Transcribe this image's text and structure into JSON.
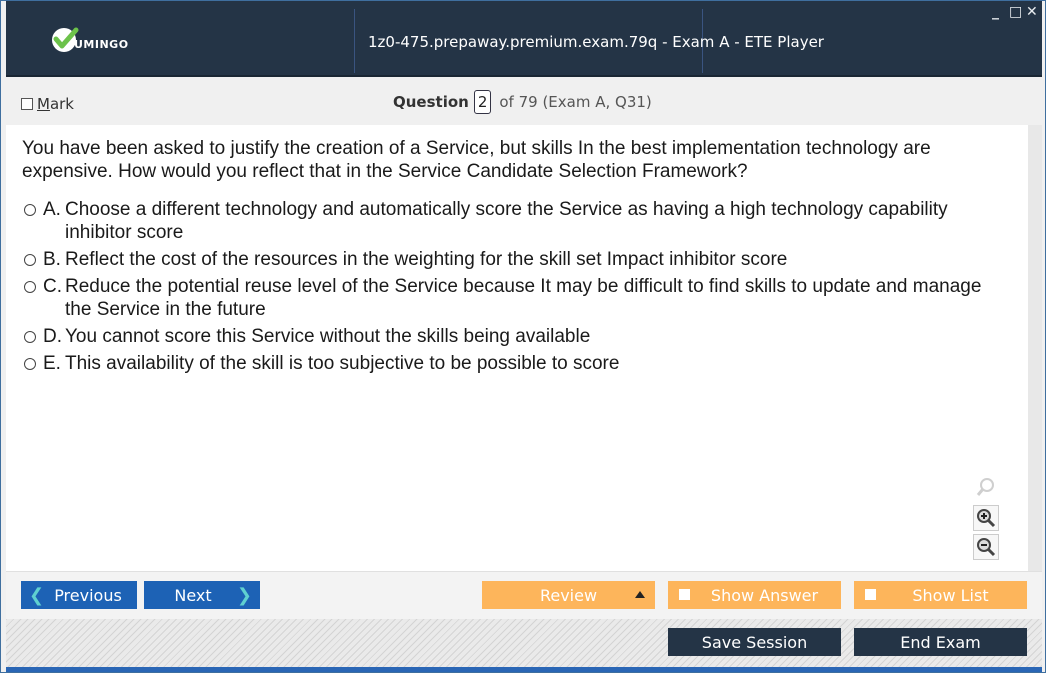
{
  "titlebar": {
    "logo_text": "UMINGO",
    "title": "1z0-475.prepaway.premium.exam.79q - Exam A - ETE Player",
    "controls": {
      "minimize": "_",
      "maximize": "□",
      "close": "✕"
    }
  },
  "header": {
    "mark_label": "Mark",
    "question_word": "Question",
    "question_number": "2",
    "of_text": "of 79 (Exam A, Q31)"
  },
  "question": {
    "text": "You have been asked to justify the creation of a Service, but skills In the best implementation technology are expensive. How would you reflect that in the Service Candidate Selection Framework?",
    "options": [
      {
        "letter": "A.",
        "text": "Choose a different technology and automatically score the Service as having a high technology capability inhibitor score"
      },
      {
        "letter": "B.",
        "text": "Reflect the cost of the resources in the weighting for the skill set Impact inhibitor score"
      },
      {
        "letter": "C.",
        "text": "Reduce the potential reuse level of the Service because It may be difficult to find skills to update and manage the Service in the future"
      },
      {
        "letter": "D.",
        "text": "You cannot score this Service without the skills being available"
      },
      {
        "letter": "E.",
        "text": "This availability of the skill is too subjective to be possible to score"
      }
    ]
  },
  "nav": {
    "previous": "Previous",
    "next": "Next",
    "review": "Review",
    "show_answer": "Show Answer",
    "show_list": "Show List"
  },
  "footer": {
    "save_session": "Save Session",
    "end_exam": "End Exam"
  },
  "colors": {
    "titlebar_bg": "#243446",
    "nav_blue": "#1d62b5",
    "orange": "#fdb55b",
    "accent_bottom": "#2a66b5"
  }
}
